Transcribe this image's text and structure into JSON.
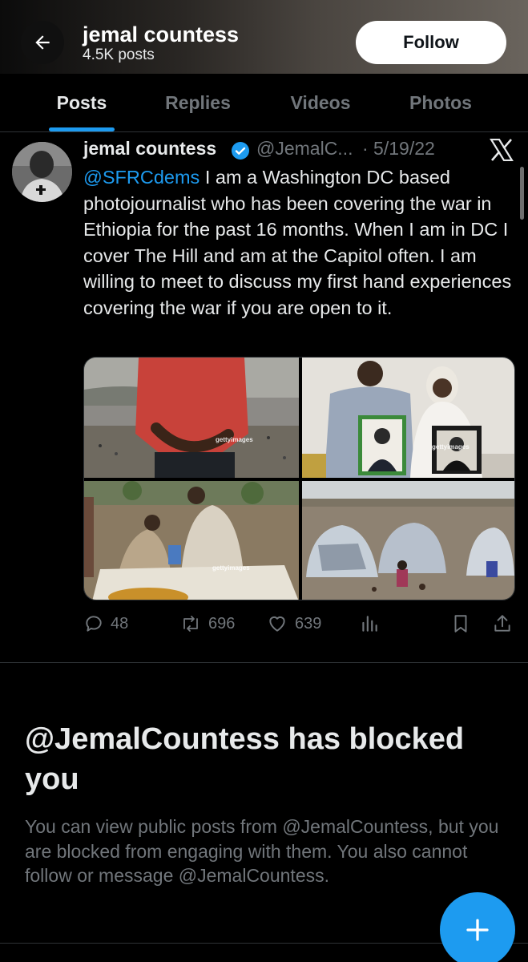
{
  "header": {
    "name": "jemal countess",
    "post_count": "4.5K posts",
    "follow_label": "Follow"
  },
  "tabs": [
    {
      "label": "Posts",
      "active": true
    },
    {
      "label": "Replies",
      "active": false
    },
    {
      "label": "Videos",
      "active": false
    },
    {
      "label": "Photos",
      "active": false
    }
  ],
  "post": {
    "author": "jemal countess",
    "handle": "@JemalC...",
    "date": "· 5/19/22",
    "mention": "@SFRCdems",
    "text": " I am a Washington DC based photojournalist who has been covering the war in Ethiopia for the past 16 months. When I am in DC I cover The Hill and am at the Capitol often. I am willing to meet to discuss my first hand experiences covering the war if you are open to it.",
    "media_watermark": "gettyimages",
    "stats": {
      "replies": "48",
      "reposts": "696",
      "likes": "639"
    }
  },
  "blocked": {
    "title": "@JemalCountess has blocked you",
    "description": "You can view public posts from @JemalCountess, but you are blocked from engaging with them. You also cannot follow or message @JemalCountess."
  },
  "icons": {
    "back": "arrow-left-icon",
    "verified": "verified-badge-icon",
    "x": "x-logo-icon",
    "reply": "reply-icon",
    "repost": "repost-icon",
    "like": "heart-icon",
    "views": "views-icon",
    "bookmark": "bookmark-icon",
    "share": "share-icon",
    "compose": "plus-icon"
  },
  "colors": {
    "accent": "#1d9bf0",
    "background": "#000000",
    "text": "#e7e9ea",
    "muted": "#71767b"
  }
}
